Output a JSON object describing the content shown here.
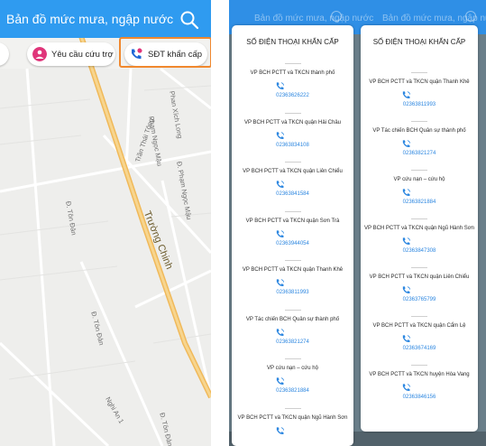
{
  "left_app": {
    "header_title": "Bản đồ mức mưa, ngập nước",
    "chips": {
      "help_label": "Yêu cầu cứu trợ",
      "sos_label": "SĐT khẩn cấp"
    },
    "streets": {
      "truong_chinh": "Trường Chinh",
      "tran_thai_tong": "Trần Thái Tông",
      "pham_ngoc_mau_1": "Phạm Ngọc Mậu",
      "pham_ngoc_mau_2": "Đ. Phạm Ngọc Mậu",
      "phan_xich_long": "Phan Xích Long",
      "ton_dan_1": "Đ. Tôn Đản",
      "ton_dan_2": "Đ. Tôn Đản",
      "ton_dan_3": "Đ. Tôn Đản",
      "nghi_an": "Nghi An 1"
    }
  },
  "right_app": {
    "header_ghost_a": "Bản đồ mức mưa, ngập nước",
    "header_ghost_b": "Bản đồ mức mưa, ngập nước",
    "modal_a": {
      "title": "SỐ ĐIỆN THOẠI KHẨN CẤP",
      "entries": [
        {
          "name": "VP BCH PCTT và TKCN thành phố",
          "phone": "02363626222"
        },
        {
          "name": "VP BCH PCTT và TKCN quận Hải Châu",
          "phone": "02363834108"
        },
        {
          "name": "VP BCH PCTT và TKCN quận Liên Chiểu",
          "phone": "02363841584"
        },
        {
          "name": "VP BCH PCTT và TKCN quận Sơn Trà",
          "phone": "02363944054"
        },
        {
          "name": "VP BCH PCTT và TKCN quận Thanh Khê",
          "phone": "02363811993"
        },
        {
          "name": "VP Tác chiến BCH Quân sự thành phố",
          "phone": "02363821274"
        },
        {
          "name": "VP cứu nạn – cứu hộ",
          "phone": "02363821884"
        },
        {
          "name": "VP BCH PCTT và TKCN quận Ngũ Hành Sơn",
          "phone": ""
        }
      ]
    },
    "modal_b": {
      "title": "SỐ ĐIỆN THOẠI KHẨN CẤP",
      "entries": [
        {
          "name": "VP BCH PCTT và TKCN quận Thanh Khê",
          "phone": "02363811993"
        },
        {
          "name": "VP Tác chiến BCH Quân sự thành phố",
          "phone": "02363821274"
        },
        {
          "name": "VP cứu nạn – cứu hộ",
          "phone": "02363821884"
        },
        {
          "name": "VP BCH PCTT và TKCN quận Ngũ Hành Sơn",
          "phone": "02363847308"
        },
        {
          "name": "VP BCH PCTT và TKCN quận Liên Chiểu",
          "phone": "02363765799"
        },
        {
          "name": "VP BCH PCTT và TKCN quận Cẩm Lệ",
          "phone": "02363674169"
        },
        {
          "name": "VP BCH PCTT và TKCN huyện Hòa Vang",
          "phone": "02363846156"
        }
      ]
    }
  },
  "colors": {
    "header_blue": "#2f9bf0",
    "highlight_orange": "#f0882e",
    "phone_link_blue": "#2b86e0",
    "road_yellow": "#f3c66a",
    "help_icon_pink": "#e0357a",
    "sos_icon_blue": "#1f67d6"
  },
  "icons": {
    "search": "search-icon",
    "help": "help-request-icon",
    "sos": "emergency-phone-icon",
    "call": "phone-call-icon",
    "refresh": "refresh-icon"
  }
}
